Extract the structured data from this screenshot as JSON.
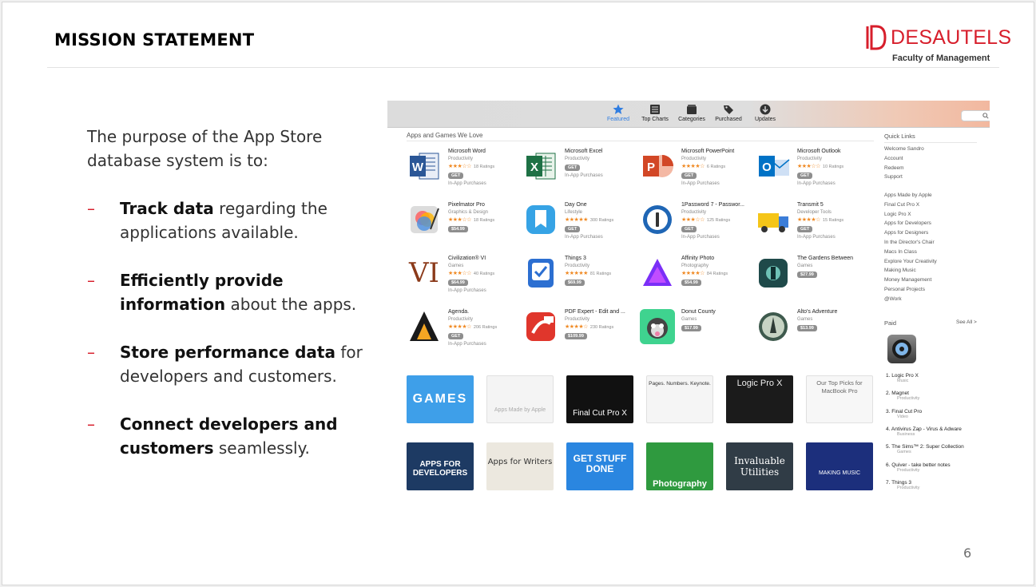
{
  "slide": {
    "title": "MISSION STATEMENT",
    "page_number": "6",
    "logo": {
      "name": "DESAUTELS",
      "subtitle": "Faculty of Management"
    },
    "intro": "The purpose of the App Store database system is to:",
    "bullets": [
      {
        "strong": "Track data",
        "rest": " regarding the applications available."
      },
      {
        "strong": "Efficiently provide information",
        "rest": " about the apps."
      },
      {
        "strong": "Store performance data",
        "rest": " for developers and customers."
      },
      {
        "strong": "Connect developers and customers",
        "rest": " seamlessly."
      }
    ],
    "bullet_marker": "–"
  },
  "store": {
    "toolbar": [
      {
        "label": "Featured",
        "icon": "star-icon"
      },
      {
        "label": "Top Charts",
        "icon": "list-icon"
      },
      {
        "label": "Categories",
        "icon": "box-icon"
      },
      {
        "label": "Purchased",
        "icon": "tag-icon"
      },
      {
        "label": "Updates",
        "icon": "download-icon"
      }
    ],
    "section_title": "Apps and Games We Love",
    "apps": [
      {
        "name": "Microsoft Word",
        "category": "Productivity",
        "stars": "★★★☆☆",
        "ratings": "18 Ratings",
        "price": "GET",
        "iap": "In-App Purchases",
        "icon": "word-icon"
      },
      {
        "name": "Microsoft Excel",
        "category": "Productivity",
        "stars": "",
        "ratings": "",
        "price": "GET",
        "iap": "In-App Purchases",
        "icon": "excel-icon"
      },
      {
        "name": "Microsoft PowerPoint",
        "category": "Productivity",
        "stars": "★★★★☆",
        "ratings": "6 Ratings",
        "price": "GET",
        "iap": "In-App Purchases",
        "icon": "powerpoint-icon"
      },
      {
        "name": "Microsoft Outlook",
        "category": "Productivity",
        "stars": "★★★☆☆",
        "ratings": "10 Ratings",
        "price": "GET",
        "iap": "In-App Purchases",
        "icon": "outlook-icon"
      },
      {
        "name": "Pixelmator Pro",
        "category": "Graphics & Design",
        "stars": "★★★☆☆",
        "ratings": "18 Ratings",
        "price": "$54.99",
        "iap": "",
        "icon": "pixelmator-icon"
      },
      {
        "name": "Day One",
        "category": "Lifestyle",
        "stars": "★★★★★",
        "ratings": "300 Ratings",
        "price": "GET",
        "iap": "In-App Purchases",
        "icon": "dayone-icon"
      },
      {
        "name": "1Password 7 - Passwor...",
        "category": "Productivity",
        "stars": "★★★☆☆",
        "ratings": "125 Ratings",
        "price": "GET",
        "iap": "In-App Purchases",
        "icon": "1password-icon"
      },
      {
        "name": "Transmit 5",
        "category": "Developer Tools",
        "stars": "★★★★☆",
        "ratings": "15 Ratings",
        "price": "GET",
        "iap": "In-App Purchases",
        "icon": "transmit-icon"
      },
      {
        "name": "Civilization® VI",
        "category": "Games",
        "stars": "★★★☆☆",
        "ratings": "40 Ratings",
        "price": "$64.99",
        "iap": "In-App Purchases",
        "icon": "civilization-icon"
      },
      {
        "name": "Things 3",
        "category": "Productivity",
        "stars": "★★★★★",
        "ratings": "81 Ratings",
        "price": "$69.99",
        "iap": "",
        "icon": "things-icon"
      },
      {
        "name": "Affinity Photo",
        "category": "Photography",
        "stars": "★★★★☆",
        "ratings": "84 Ratings",
        "price": "$54.99",
        "iap": "",
        "icon": "affinity-icon"
      },
      {
        "name": "The Gardens Between",
        "category": "Games",
        "stars": "",
        "ratings": "",
        "price": "$27.99",
        "iap": "",
        "icon": "gardens-icon"
      },
      {
        "name": "Agenda.",
        "category": "Productivity",
        "stars": "★★★★☆",
        "ratings": "206 Ratings",
        "price": "GET",
        "iap": "In-App Purchases",
        "icon": "agenda-icon"
      },
      {
        "name": "PDF Expert - Edit and ...",
        "category": "Productivity",
        "stars": "★★★★☆",
        "ratings": "230 Ratings",
        "price": "$109.99",
        "iap": "",
        "icon": "pdfexpert-icon"
      },
      {
        "name": "Donut County",
        "category": "Games",
        "stars": "",
        "ratings": "",
        "price": "$17.99",
        "iap": "",
        "icon": "donut-icon"
      },
      {
        "name": "Alto's Adventure",
        "category": "Games",
        "stars": "",
        "ratings": "",
        "price": "$13.99",
        "iap": "",
        "icon": "alto-icon"
      }
    ],
    "tiles_row1": [
      {
        "text": "GAMES",
        "bg": "#3e9fe9"
      },
      {
        "text": "Apps Made by Apple",
        "bg": "#f4f4f4"
      },
      {
        "text": "Final Cut Pro X",
        "bg": "#111111"
      },
      {
        "text": "Pages. Numbers. Keynote.",
        "bg": "#f5f5f5"
      },
      {
        "text": "Logic Pro X",
        "bg": "#1b1b1b"
      },
      {
        "text": "Our Top Picks for MacBook Pro",
        "bg": "#f7f7f7"
      }
    ],
    "tiles_row2": [
      {
        "text": "APPS FOR DEVELOPERS",
        "bg": "#1d3a63"
      },
      {
        "text": "Apps for Writers",
        "bg": "#ece8df"
      },
      {
        "text": "GET STUFF DONE",
        "bg": "#2a86e0"
      },
      {
        "text": "Photography",
        "bg": "#2f9a3f"
      },
      {
        "text": "Invaluable Utilities",
        "bg": "#303c46"
      },
      {
        "text": "MAKING MUSIC",
        "bg": "#1c2f7c"
      }
    ],
    "quick_links_title": "Quick Links",
    "quick_links": [
      "Welcome Sandro",
      "Account",
      "Redeem",
      "Support"
    ],
    "collections": [
      "Apps Made by Apple",
      "Final Cut Pro X",
      "Logic Pro X",
      "Apps for Developers",
      "Apps for Designers",
      "In the Director's Chair",
      "Macs In Class",
      "Explore Your Creativity",
      "Making Music",
      "Money Management",
      "Personal Projects",
      "@Work"
    ],
    "paid_title": "Paid",
    "see_all": "See All >",
    "paid": [
      {
        "rank": "1.",
        "name": "Logic Pro X",
        "cat": "Music"
      },
      {
        "rank": "2.",
        "name": "Magnet",
        "cat": "Productivity"
      },
      {
        "rank": "3.",
        "name": "Final Cut Pro",
        "cat": "Video"
      },
      {
        "rank": "4.",
        "name": "Antivirus Zap - Virus & Adware",
        "cat": "Business"
      },
      {
        "rank": "5.",
        "name": "The Sims™ 2: Super Collection",
        "cat": "Games"
      },
      {
        "rank": "6.",
        "name": "Quiver - take better notes",
        "cat": "Productivity"
      },
      {
        "rank": "7.",
        "name": "Things 3",
        "cat": "Productivity"
      }
    ]
  }
}
